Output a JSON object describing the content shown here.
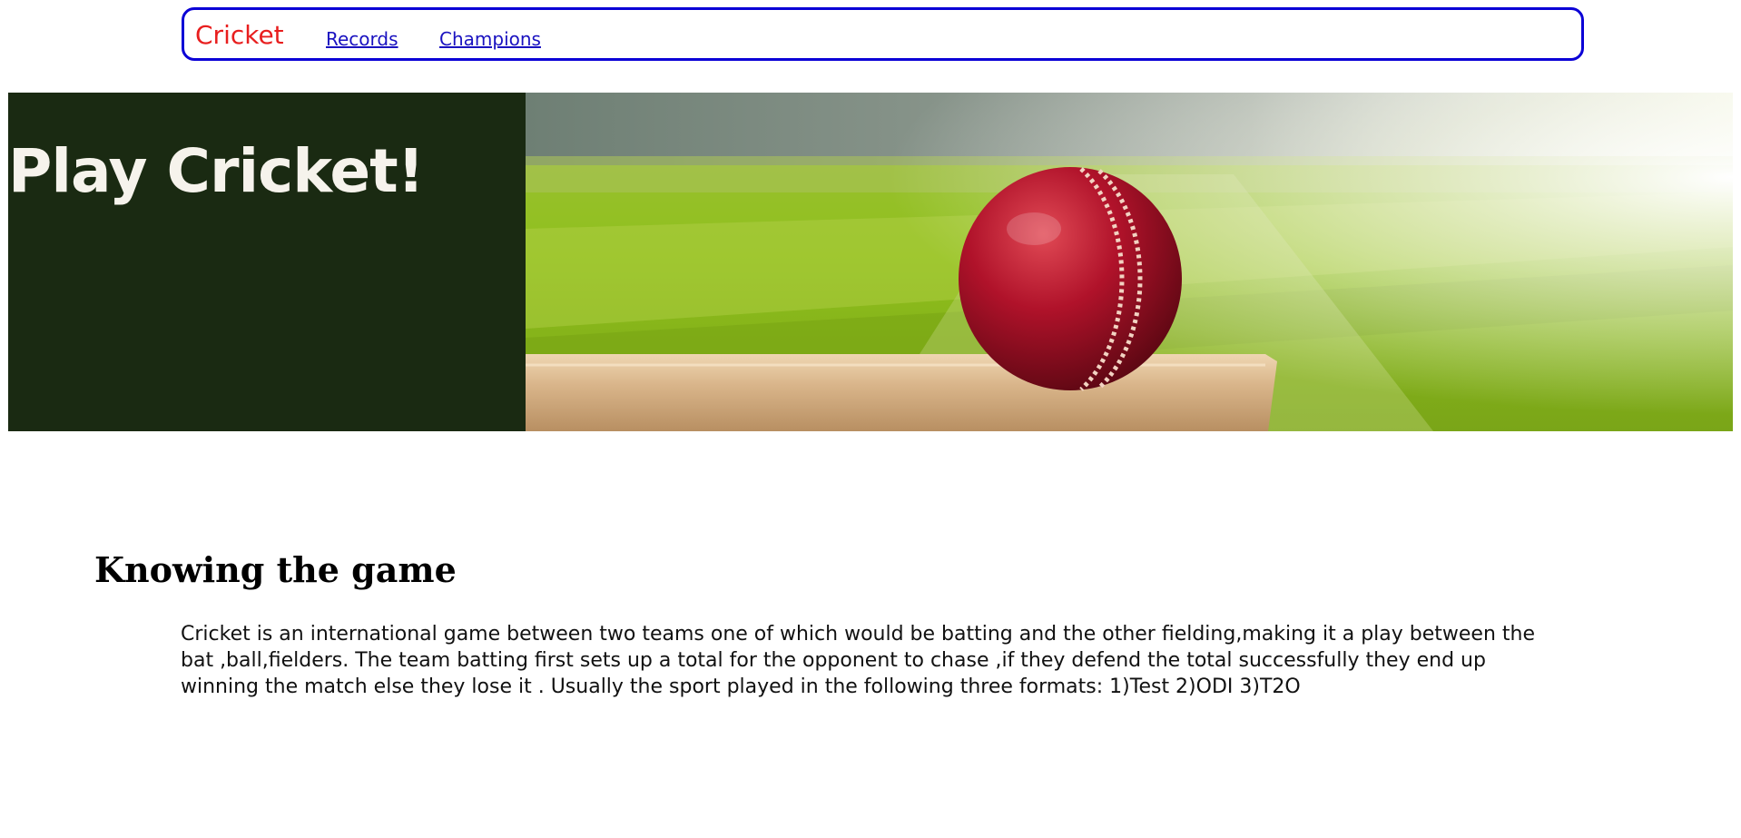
{
  "nav": {
    "brand": "Cricket",
    "links": [
      "Records",
      "Champions"
    ]
  },
  "hero": {
    "title": "Play Cricket!"
  },
  "section": {
    "heading": "Knowing the game",
    "body": "Cricket is an international game between two teams one of which would be batting and the other fielding,making it a play between the bat ,ball,fielders. The team batting first sets up a total for the opponent to chase ,if they defend the total successfully they end up winning the match else they lose it . Usually the sport played in the following three formats: 1)Test 2)ODI 3)T2O"
  },
  "colors": {
    "brand": "#e81e1e",
    "nav_border": "#0b00d6",
    "link": "#1a12c0",
    "hero_panel": "#1a2a12"
  }
}
